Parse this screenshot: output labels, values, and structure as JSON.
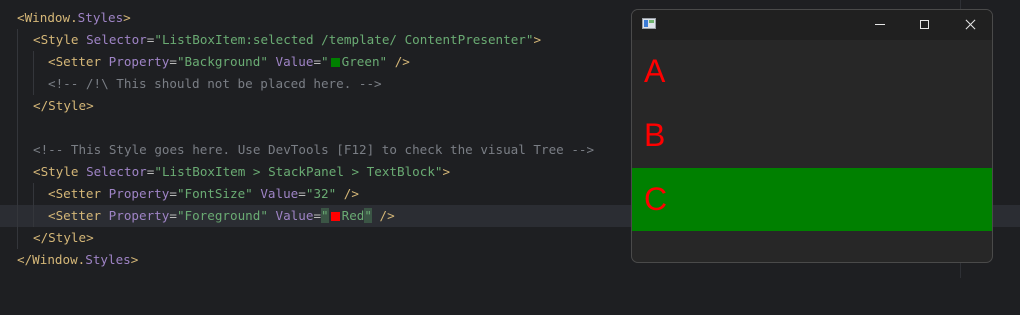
{
  "code": {
    "l1": {
      "open": "<",
      "tag": "Window.",
      "tag2": "Styles",
      "close": ">"
    },
    "l2": {
      "open": "<",
      "tag": "Style ",
      "attr": "Selector",
      "eq": "=",
      "val": "\"ListBoxItem:selected /template/ ContentPresenter\"",
      "close": ">"
    },
    "l3": {
      "open": "<",
      "tag": "Setter ",
      "attr1": "Property",
      "eq1": "=",
      "val1": "\"Background\" ",
      "attr2": "Value",
      "eq2": "=",
      "q1": "\"",
      "val2": "Green",
      "q2": "\"",
      "close": " />"
    },
    "l4": {
      "comment": "<!-- /!\\ This should not be placed here. -->"
    },
    "l5": {
      "open": "</",
      "tag": "Style",
      "close": ">"
    },
    "l7": {
      "comment": "<!-- This Style goes here. Use DevTools [F12] to check the visual Tree -->"
    },
    "l8": {
      "open": "<",
      "tag": "Style ",
      "attr": "Selector",
      "eq": "=",
      "val": "\"ListBoxItem > StackPanel > TextBlock\"",
      "close": ">"
    },
    "l9": {
      "open": "<",
      "tag": "Setter ",
      "attr1": "Property",
      "eq1": "=",
      "val1": "\"FontSize\" ",
      "attr2": "Value",
      "eq2": "=",
      "val2": "\"32\"",
      "close": " />"
    },
    "l10": {
      "open": "<",
      "tag": "Setter ",
      "attr1": "Property",
      "eq1": "=",
      "val1": "\"Foreground\" ",
      "attr2": "Value",
      "eq2": "=",
      "q1": "\"",
      "val2": "Red",
      "q2": "\"",
      "close": " />"
    },
    "l11": {
      "open": "</",
      "tag": "Style",
      "close": ">"
    },
    "l12": {
      "open": "</",
      "tag": "Window.",
      "tag2": "Styles",
      "close": ">"
    }
  },
  "colors": {
    "green_swatch": "#008000",
    "red_swatch": "#ff0000",
    "selected_bg": "#008000",
    "item_fg": "#ff0000"
  },
  "window": {
    "icon": "app-icon",
    "items": [
      {
        "label": "A",
        "selected": false
      },
      {
        "label": "B",
        "selected": false
      },
      {
        "label": "C",
        "selected": true
      }
    ]
  }
}
